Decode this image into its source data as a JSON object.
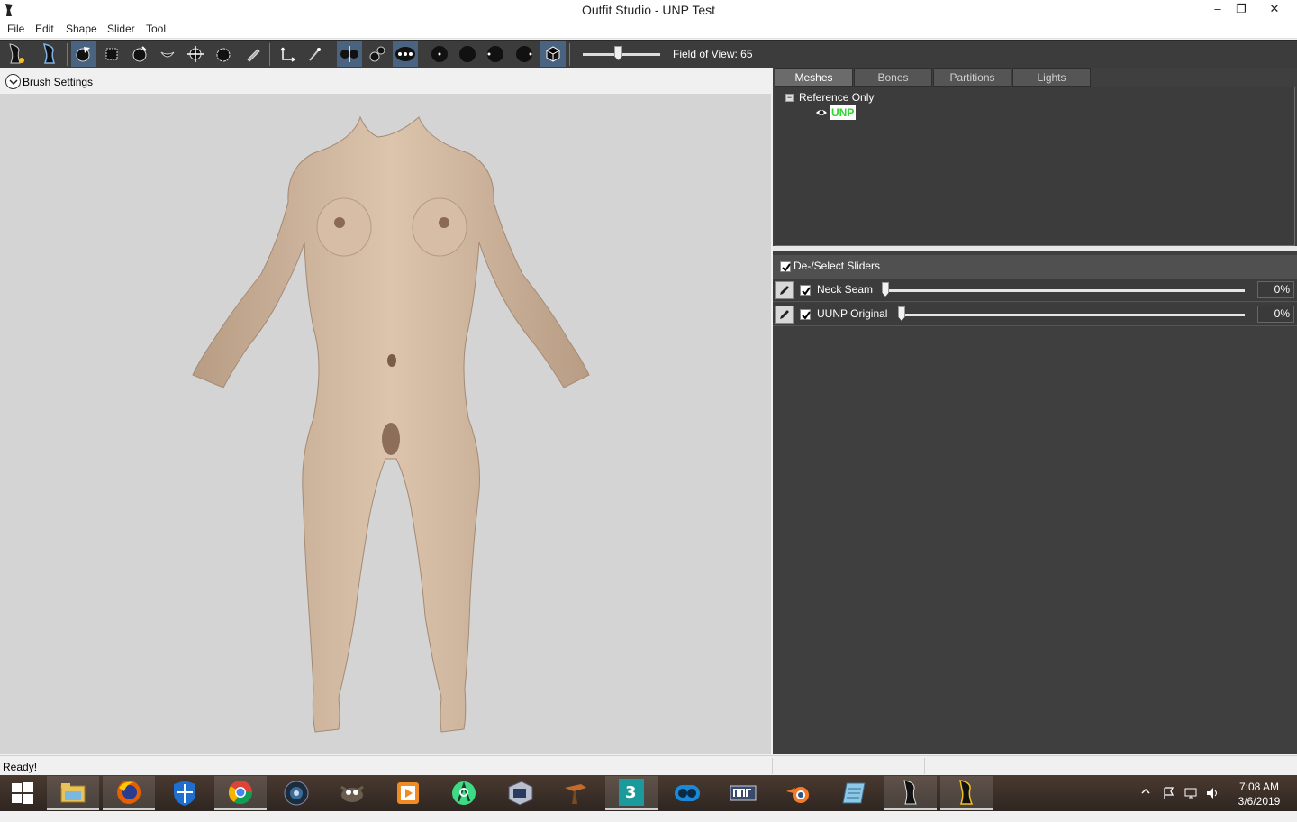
{
  "window": {
    "title": "Outfit Studio - UNP Test",
    "controls": {
      "minimize": "–",
      "maximize": "❐",
      "close": "✕"
    }
  },
  "menu": {
    "items": [
      "File",
      "Edit",
      "Shape",
      "Slider",
      "Tool"
    ]
  },
  "toolbar": {
    "field_of_view_label": "Field of View: 65",
    "fov_value": 65,
    "tools": [
      "load-reference-icon",
      "load-outfit-icon",
      "select-tool-icon",
      "mask-tool-icon",
      "inflate-tool-icon",
      "deflate-tool-icon",
      "move-tool-icon",
      "smooth-tool-icon",
      "weight-tool-icon",
      "transform-tool-icon",
      "pivot-tool-icon",
      "mirror-x-icon",
      "connected-only-icon",
      "global-brush-icon",
      "brush-size-1-icon",
      "brush-size-2-icon",
      "brush-size-3-icon",
      "brush-size-4-icon",
      "texture-toggle-icon"
    ]
  },
  "brush_settings": {
    "label": "Brush Settings"
  },
  "tabs": [
    "Meshes",
    "Bones",
    "Partitions",
    "Lights"
  ],
  "active_tab": "Meshes",
  "mesh_tree": {
    "group_label": "Reference Only",
    "mesh_label": "UNP",
    "mesh_color": "#2fd52f"
  },
  "sliders": {
    "header_label": "De-/Select Sliders",
    "items": [
      {
        "name": "Neck Seam",
        "value": "0%",
        "checked": true
      },
      {
        "name": "UUNP Original",
        "value": "0%",
        "checked": true
      }
    ]
  },
  "status": {
    "text": "Ready!"
  },
  "taskbar": {
    "apps": [
      "windows-start-icon",
      "file-explorer-icon",
      "firefox-icon",
      "windows-security-icon",
      "chrome-icon",
      "camera-app-icon",
      "gimp-icon",
      "media-player-icon",
      "android-studio-icon",
      "game-launcher-icon",
      "blacksmith-tool-icon",
      "3ds-max-icon",
      "mod-organizer-icon",
      "nifskope-icon",
      "blender-icon",
      "notepad-icon",
      "bodyslide-icon",
      "outfit-studio-icon"
    ],
    "clock_time": "7:08 AM",
    "clock_date": "3/6/2019"
  },
  "colors": {
    "toolbar_bg": "#3c3c3c",
    "viewport_bg": "#d4d4d4",
    "panel_bg": "#3f3f3f",
    "active_tool": "#4a6380",
    "skin": "#d9bfa6"
  }
}
